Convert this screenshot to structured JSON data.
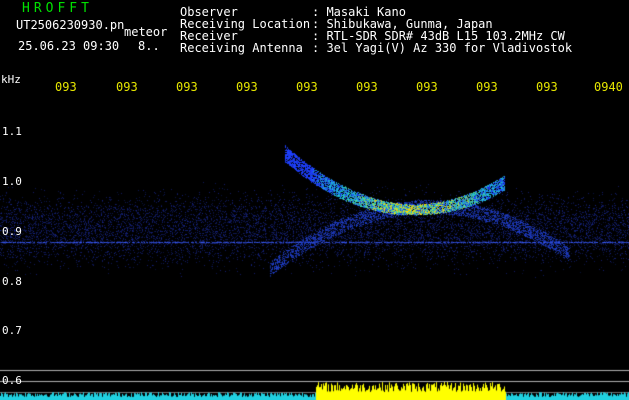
{
  "app": {
    "name": "HROFFT",
    "filename": "UT2506230930.pn",
    "mode": "meteor",
    "datetime": "25.06.23 09:30",
    "counter": "8.."
  },
  "header": {
    "rows": [
      {
        "label": "Observer",
        "value": ": Masaki Kano"
      },
      {
        "label": "Receiving Location",
        "value": ": Shibukawa, Gunma, Japan"
      },
      {
        "label": "Receiver",
        "value": ": RTL-SDR SDR# 43dB L15 103.2MHz CW"
      },
      {
        "label": "Receiving Antenna",
        "value": ": 3el Yagi(V) Az 330 for Vladivostok"
      }
    ]
  },
  "axes": {
    "y_unit": "kHz",
    "y_ticks": [
      "1.1",
      "1.0",
      "0.9",
      "0.8",
      "0.7",
      "0.6"
    ],
    "x_ticks": [
      "093",
      "093",
      "093",
      "093",
      "093",
      "093",
      "093",
      "093",
      "093",
      "0940"
    ]
  },
  "colors": {
    "background": "#000000",
    "text_green": "#00e000",
    "text_white": "#ffffff",
    "text_yellow": "#e6e600",
    "signal_low": "#1e2aa0",
    "signal_mid": "#20c0d0",
    "signal_high": "#ffe000",
    "level_bar": "#20d0e0",
    "level_peak": "#ffff00"
  }
}
